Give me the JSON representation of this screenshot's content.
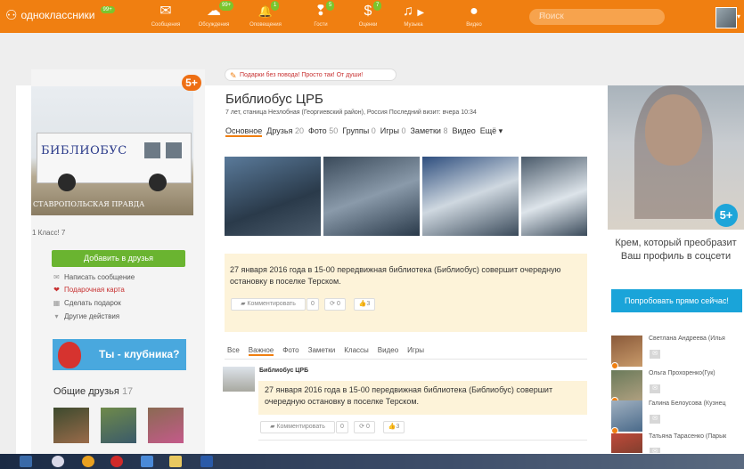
{
  "topbar": {
    "logo": "одноклассники",
    "logo_badge": "99+",
    "nav": [
      {
        "label": "Сообщения",
        "icon": "envelope-icon",
        "glyph": "✉",
        "badge": ""
      },
      {
        "label": "Обсуждения",
        "icon": "discussions-icon",
        "glyph": "☁",
        "badge": "99+"
      },
      {
        "label": "Оповещения",
        "icon": "bell-icon",
        "glyph": "🔔",
        "badge": "1"
      },
      {
        "label": "Гости",
        "icon": "footprints-icon",
        "glyph": "❢",
        "badge": "5"
      },
      {
        "label": "Оценки",
        "icon": "ratings-icon",
        "glyph": "$",
        "badge": "7"
      },
      {
        "label": "Музыка",
        "icon": "music-icon",
        "glyph": "♫",
        "badge": ""
      },
      {
        "label": "Видео",
        "icon": "video-icon",
        "glyph": "●",
        "badge": ""
      }
    ],
    "search_placeholder": "Поиск"
  },
  "profile": {
    "gift_pill": "Подарки без повода! Просто так! От души!",
    "name": "Библиобус ЦРБ",
    "meta": "7 лет, станица Незлобная (Георгиевский район), Россия  Последний визит: вчера 10:34",
    "tabs": [
      {
        "label": "Основное",
        "count": ""
      },
      {
        "label": "Друзья",
        "count": "20"
      },
      {
        "label": "Фото",
        "count": "50"
      },
      {
        "label": "Группы",
        "count": "0"
      },
      {
        "label": "Игры",
        "count": "0"
      },
      {
        "label": "Заметки",
        "count": "8"
      },
      {
        "label": "Видео",
        "count": ""
      },
      {
        "label": "Ещё ▾",
        "count": ""
      }
    ],
    "photo_text": "БИБЛИОБУС",
    "photo_caption": "СТАВРОПОЛЬСКАЯ ПРАВДА",
    "badge_5plus": "5+",
    "stats": "1  Класс! 7"
  },
  "left": {
    "add_friend": "Добавить в друзья",
    "actions": [
      {
        "label": "Написать сообщение",
        "icon": "envelope-icon",
        "glyph": "✉",
        "color": "#555555"
      },
      {
        "label": "Подарочная карта",
        "icon": "gift-icon",
        "glyph": "❤",
        "color": "#c83232"
      },
      {
        "label": "Сделать подарок",
        "icon": "present-icon",
        "glyph": "▦",
        "color": "#555555"
      },
      {
        "label": "Другие действия",
        "icon": "chevron-down-icon",
        "glyph": "▾",
        "color": "#555555"
      }
    ],
    "promo": "Ты - клубника?",
    "common_friends_title": "Общие друзья",
    "common_friends_count": "17"
  },
  "status": {
    "text": "27 января 2016 года в 15-00 передвижная библиотека (Библиобус) совершит очередную остановку в поселке Терском.",
    "comment": "Комментировать",
    "comment_count": "0",
    "share_count": "0",
    "like_count": "3"
  },
  "feed": {
    "tabs": [
      "Все",
      "Важное",
      "Фото",
      "Заметки",
      "Классы",
      "Видео",
      "Игры"
    ],
    "author": "Библиобус ЦРБ",
    "text": "27 января 2016 года в 15-00 передвижная библиотека (Библиобус) совершит очередную остановку в поселке Терском.",
    "comment": "Комментировать",
    "comment_count": "0",
    "share_count": "0",
    "like_count": "3"
  },
  "ad": {
    "badge": "5+",
    "text": "Крем, который преобразит Ваш профиль в соцсети",
    "button": "Попробовать прямо сейчас!"
  },
  "friends": [
    {
      "name": "Светлана Андреева (Илья"
    },
    {
      "name": "Ольга Прохоренко(Гук)"
    },
    {
      "name": "Галина Белоусова (Кузнец"
    },
    {
      "name": "Татьяна Тарасенко (Парык"
    }
  ],
  "colors": {
    "brand": "#f07f11",
    "green": "#6ab430",
    "blue": "#1aa4d9"
  }
}
